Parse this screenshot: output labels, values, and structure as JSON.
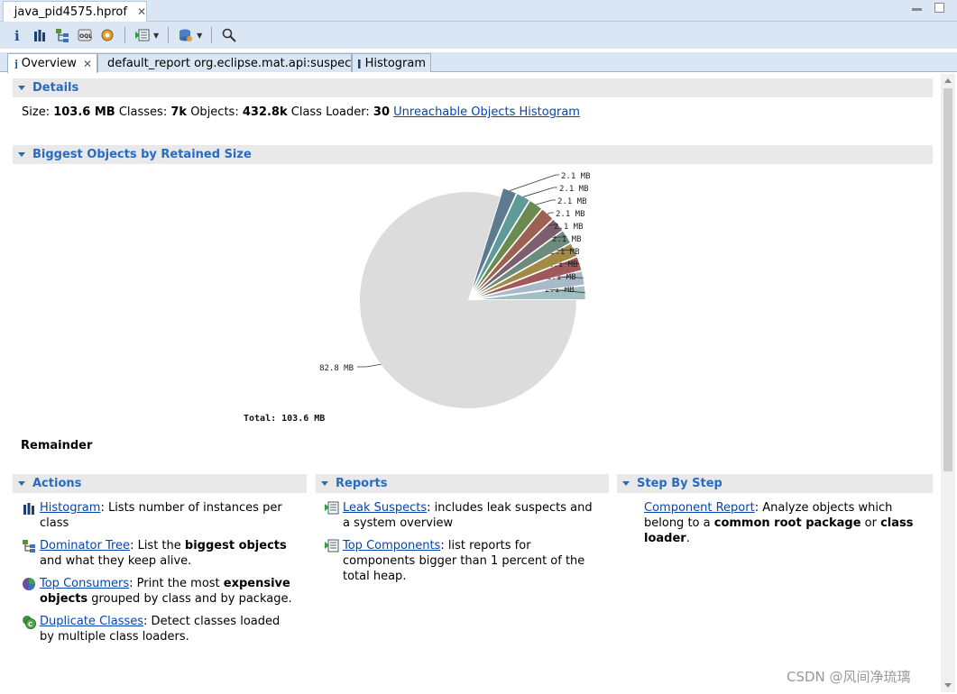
{
  "editor": {
    "file_tab_label": "java_pid4575.hprof"
  },
  "tabs": [
    {
      "label": "Overview"
    },
    {
      "label": "default_report  org.eclipse.mat.api:suspects"
    },
    {
      "label": "Histogram"
    }
  ],
  "details": {
    "title": "Details",
    "size_label": "Size:",
    "size_value": "103.6 MB",
    "classes_label": "Classes:",
    "classes_value": "7k",
    "objects_label": "Objects:",
    "objects_value": "432.8k",
    "loader_label": "Class Loader:",
    "loader_value": "30",
    "unreachable_link": "Unreachable Objects Histogram"
  },
  "biggest": {
    "title": "Biggest Objects by Retained Size",
    "remainder_label": "Remainder"
  },
  "chart_data": {
    "type": "pie",
    "unit": "MB",
    "slices": [
      {
        "label": "2.1 MB",
        "value": 2.1,
        "color": "#9fbfc1"
      },
      {
        "label": "2.1 MB",
        "value": 2.1,
        "color": "#a8b9c9"
      },
      {
        "label": "2.1 MB",
        "value": 2.1,
        "color": "#a0585d"
      },
      {
        "label": "2.1 MB",
        "value": 2.1,
        "color": "#a08a45"
      },
      {
        "label": "2.1 MB",
        "value": 2.1,
        "color": "#6d8b7c"
      },
      {
        "label": "2.1 MB",
        "value": 2.1,
        "color": "#7d5e6e"
      },
      {
        "label": "2.1 MB",
        "value": 2.1,
        "color": "#9c6150"
      },
      {
        "label": "2.1 MB",
        "value": 2.1,
        "color": "#6a8a4f"
      },
      {
        "label": "2.1 MB",
        "value": 2.1,
        "color": "#5e9b98"
      },
      {
        "label": "2.1 MB",
        "value": 2.1,
        "color": "#5d7a8f"
      },
      {
        "label": "82.8 MB",
        "value": 82.8,
        "color": "#dcdcdc"
      }
    ],
    "total_label": "Total: 103.6 MB"
  },
  "actions": {
    "title": "Actions",
    "items": [
      {
        "link": "Histogram",
        "desc_parts": [
          ": Lists number of instances per class"
        ]
      },
      {
        "link": "Dominator Tree",
        "desc_parts": [
          ": List the ",
          "biggest objects",
          " and what they keep alive."
        ]
      },
      {
        "link": "Top Consumers",
        "desc_parts": [
          ": Print the most ",
          "expensive objects",
          " grouped by class and by package."
        ]
      },
      {
        "link": "Duplicate Classes",
        "desc_parts": [
          ": Detect classes loaded by multiple class loaders."
        ]
      }
    ]
  },
  "reports": {
    "title": "Reports",
    "items": [
      {
        "link": "Leak Suspects",
        "desc": ": includes leak suspects and a system overview"
      },
      {
        "link": "Top Components",
        "desc": ": list reports for components bigger than 1 percent of the total heap."
      }
    ]
  },
  "step": {
    "title": "Step By Step",
    "link": "Component Report",
    "desc_a": ": Analyze objects which belong to a ",
    "bold_a": "common root package",
    "desc_b": " or ",
    "bold_b": "class loader",
    "desc_c": "."
  },
  "watermark": "CSDN @风间净琉璃"
}
